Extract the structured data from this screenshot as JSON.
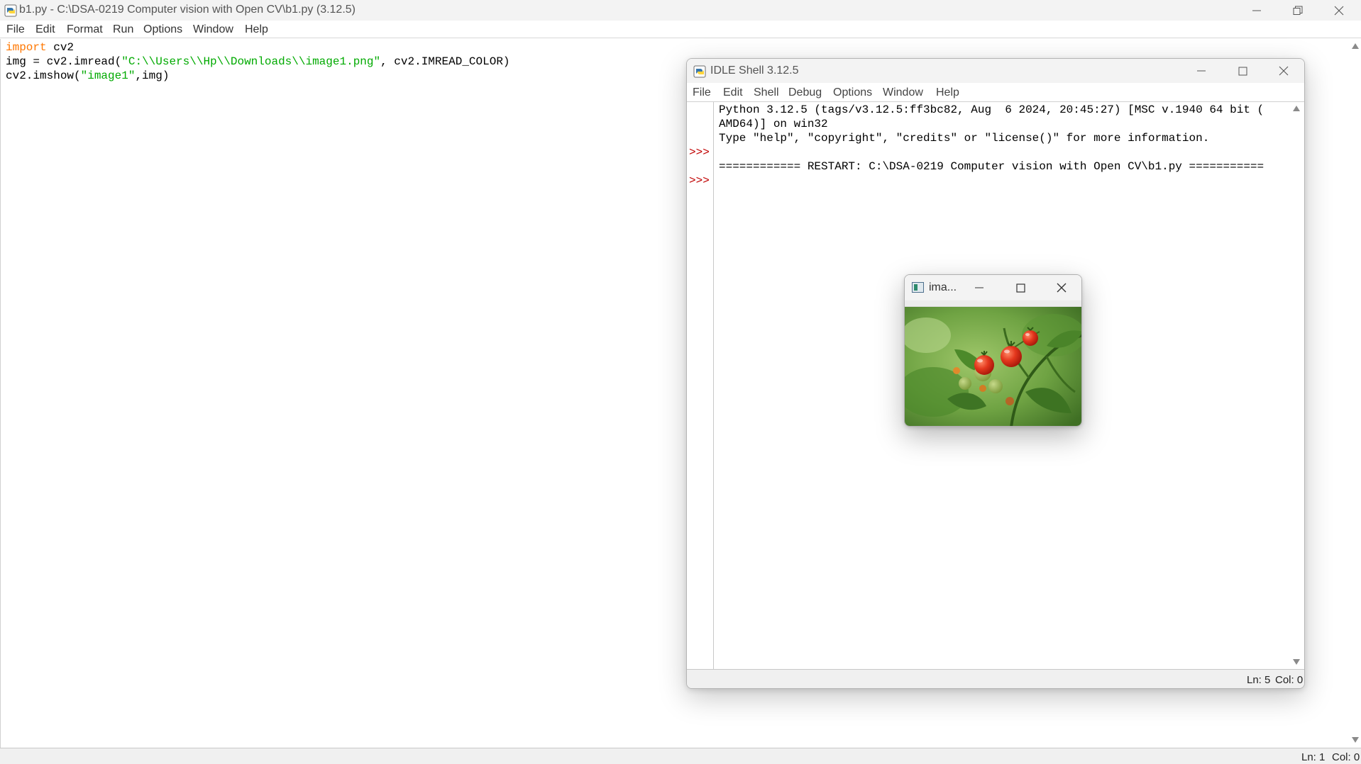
{
  "editor_window": {
    "title": "b1.py - C:\\DSA-0219 Computer vision with Open CV\\b1.py (3.12.5)",
    "menu": [
      "File",
      "Edit",
      "Format",
      "Run",
      "Options",
      "Window",
      "Help"
    ],
    "code": {
      "line1": {
        "kw": "import",
        "rest": " cv2"
      },
      "line2": {
        "pre": "img = cv2.imread(",
        "str": "\"C:\\\\Users\\\\Hp\\\\Downloads\\\\image1.png\"",
        "post": ", cv2.IMREAD_COLOR)"
      },
      "line3": {
        "pre": "cv2.imshow(",
        "str": "\"image1\"",
        "post": ",img)"
      }
    },
    "status": {
      "ln": "Ln: 1",
      "col": "Col: 0"
    }
  },
  "shell_window": {
    "title": "IDLE Shell 3.12.5",
    "menu": [
      "File",
      "Edit",
      "Shell",
      "Debug",
      "Options",
      "Window",
      "Help"
    ],
    "output": [
      "Python 3.12.5 (tags/v3.12.5:ff3bc82, Aug  6 2024, 20:45:27) [MSC v.1940 64 bit (",
      "AMD64)] on win32",
      "Type \"help\", \"copyright\", \"credits\" or \"license()\" for more information.",
      "",
      "============ RESTART: C:\\DSA-0219 Computer vision with Open CV\\b1.py ==========="
    ],
    "prompts": [
      ">>>",
      ">>>"
    ],
    "status": {
      "ln": "Ln: 5",
      "col": "Col: 0"
    }
  },
  "image_window": {
    "title": "ima...",
    "image_icon": "opencv-window-icon",
    "image_subject": "tomato-plant-photo"
  },
  "icons": {
    "app": "python-idle-icon",
    "minimize": "minimize-icon",
    "maximize": "maximize-icon",
    "restore": "restore-icon",
    "close": "close-icon"
  },
  "colors": {
    "keyword": "#ff7700",
    "string": "#00aa00",
    "prompt": "#c00000",
    "tomato": "#e4371d"
  }
}
